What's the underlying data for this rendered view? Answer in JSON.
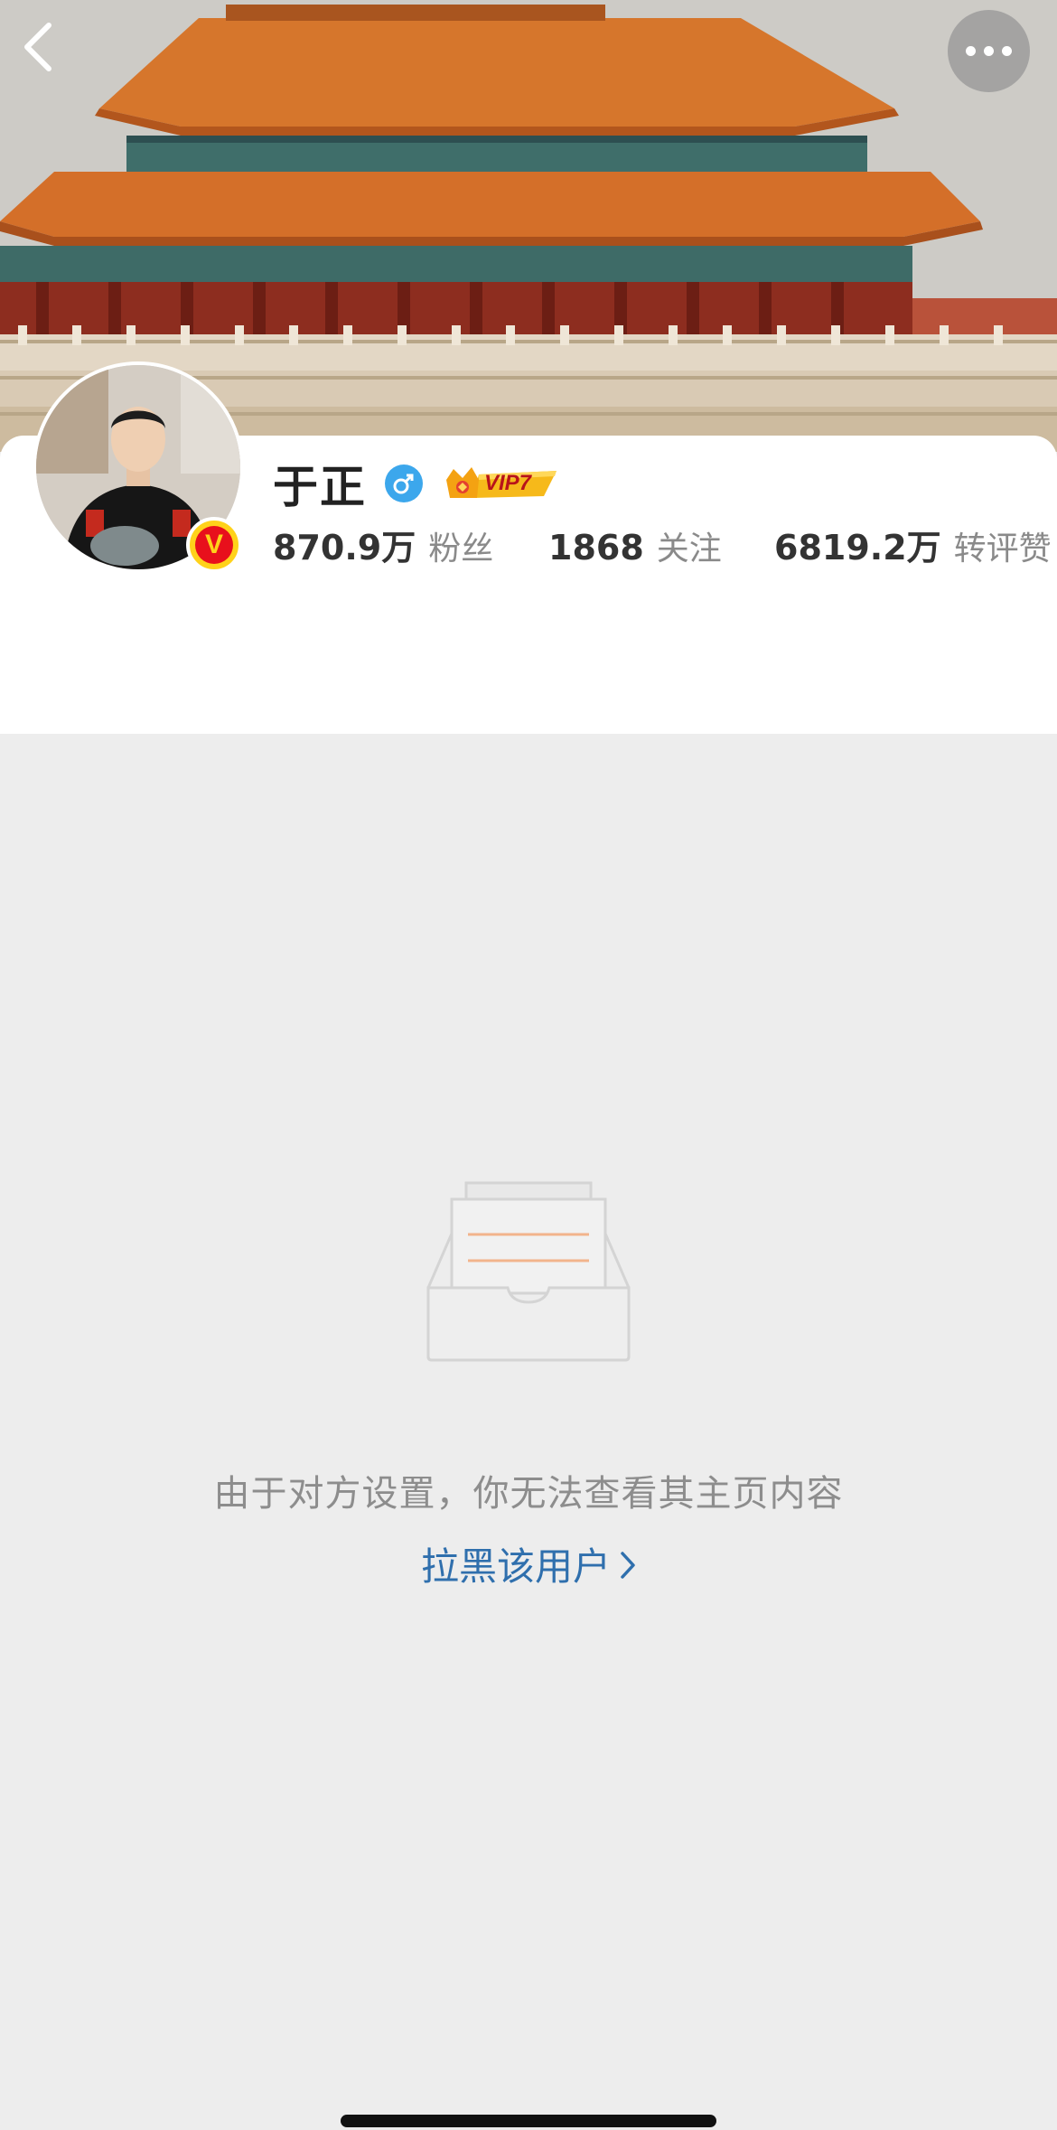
{
  "header": {
    "back_icon": "chevron-left-icon",
    "more_icon": "ellipsis-icon"
  },
  "profile": {
    "name": "于正",
    "gender_icon": "male-icon",
    "vip_label": "VIP7",
    "verified_badge": "V",
    "stats": [
      {
        "value": "870.9万",
        "label": "粉丝"
      },
      {
        "value": "1868",
        "label": "关注"
      },
      {
        "value": "6819.2万",
        "label": "转评赞"
      }
    ]
  },
  "empty_state": {
    "icon": "empty-inbox-icon",
    "message": "由于对方设置，你无法查看其主页内容",
    "action_label": "拉黑该用户",
    "action_icon": "chevron-right-icon"
  },
  "colors": {
    "link": "#2f6fad",
    "verified_red": "#e8101c",
    "verified_gold": "#ffd21a",
    "gender_blue": "#3ca7ec",
    "background": "#ededed"
  }
}
